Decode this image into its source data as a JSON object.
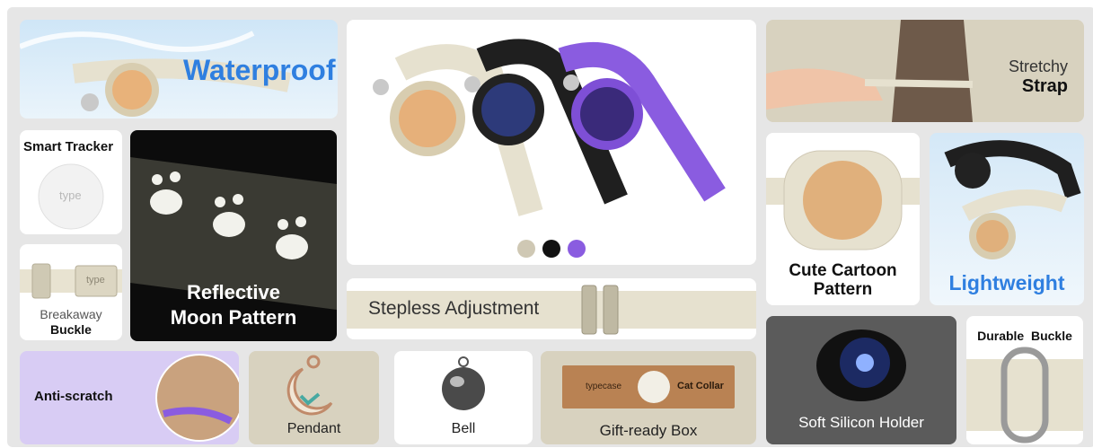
{
  "colors": {
    "frame": "#e6e6e6",
    "waterproof_text": "#2f7fe0",
    "lightweight_text": "#2f7fe0",
    "cream": "#e6e1cf",
    "purple": "#8a5ce0",
    "black": "#141414",
    "beige_card": "#d8d2bf",
    "lavender_card": "#d8ccf4",
    "charcoal_card": "#5b5b5b"
  },
  "features": {
    "waterproof": "Waterproof",
    "smart_tracker": "Smart Tracker",
    "tracker_brand": "type",
    "breakaway_line1": "Breakaway",
    "breakaway_line2": "Buckle",
    "buckle_brand": "type",
    "reflective_line1": "Reflective",
    "reflective_line2": "Moon Pattern",
    "stepless": "Stepless Adjustment",
    "stretchy_line1": "Stretchy",
    "stretchy_line2": "Strap",
    "cartoon_line1": "Cute Cartoon",
    "cartoon_line2": "Pattern",
    "lightweight": "Lightweight",
    "anti_scratch": "Anti-scratch",
    "pendant": "Pendant",
    "bell": "Bell",
    "gift_box": "Gift-ready Box",
    "box_brand": "typecase",
    "box_product": "Cat Collar",
    "soft_silicon": "Soft Silicon Holder",
    "durable_buckle": "Durable  Buckle"
  },
  "color_options": [
    {
      "name": "cream",
      "hex": "#cfc8b4"
    },
    {
      "name": "black",
      "hex": "#111111"
    },
    {
      "name": "purple",
      "hex": "#8a5ce0"
    }
  ]
}
